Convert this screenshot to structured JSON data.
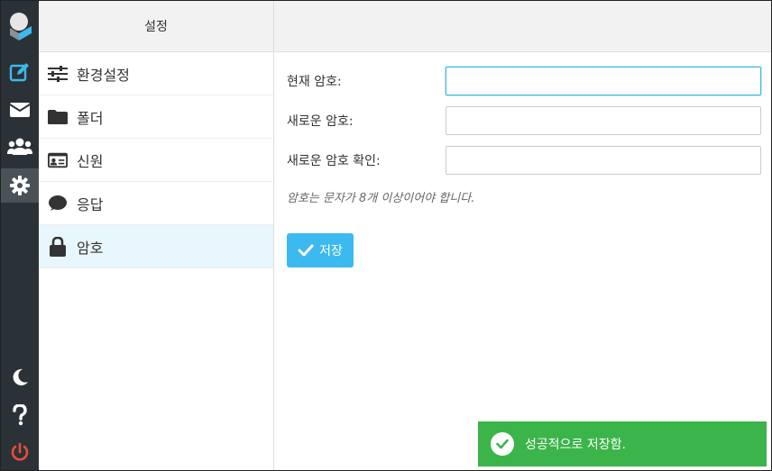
{
  "sidebar": {
    "title": "설정",
    "items": [
      {
        "label": "환경설정",
        "icon": "sliders-icon"
      },
      {
        "label": "폴더",
        "icon": "folder-icon"
      },
      {
        "label": "신원",
        "icon": "id-card-icon"
      },
      {
        "label": "응답",
        "icon": "speech-bubble-icon"
      },
      {
        "label": "암호",
        "icon": "lock-icon"
      }
    ],
    "selected": "암호"
  },
  "form": {
    "current_password": {
      "label": "현재 암호:",
      "value": ""
    },
    "new_password": {
      "label": "새로운 암호:",
      "value": ""
    },
    "confirm_password": {
      "label": "새로운 암호 확인:",
      "value": ""
    },
    "hint": "암호는 문자가 8개 이상이어야 합니다.",
    "save_label": "저장"
  },
  "toast": {
    "message": "성공적으로 저장함."
  },
  "colors": {
    "rail_bg": "#2b3237",
    "accent": "#3cb9ee",
    "success": "#3bb54a",
    "power": "#e74c3c",
    "selected_bg": "#e8f6fd"
  }
}
